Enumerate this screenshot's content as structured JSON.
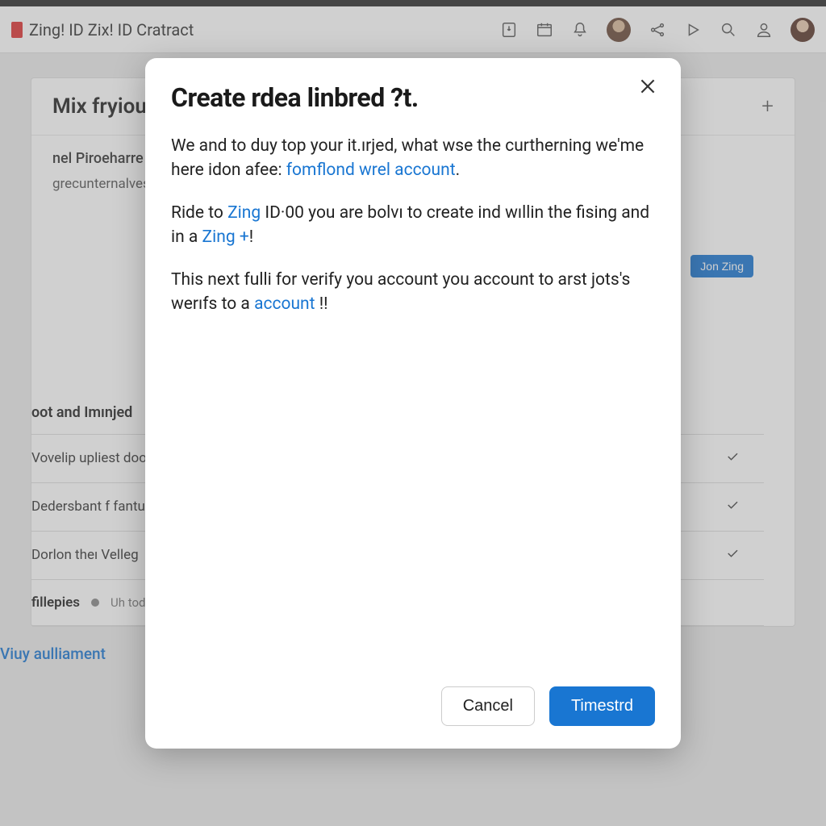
{
  "header": {
    "breadcrumb": "Zing! ID Zix! ID Cratract"
  },
  "bg": {
    "card_title": "Mix fryiou IBe",
    "section_label": "nel Piroeharre",
    "section_sub": "grecunternalves hav led but,",
    "pill": "Jon Zing",
    "list_header": "oot and Imınjed",
    "rows": [
      "Vovelip upliest doos'ro ıiltern Dorign",
      "Dedersbant f fantue to",
      "Dorlon theı Velleg"
    ],
    "filters_label": "fillepies",
    "filters_sub": "Uh tod",
    "link": "Viuy aulliament"
  },
  "modal": {
    "title": "Create rdea linbred ?t.",
    "p1_a": "We and to duy top your it.ırjed, what wse the curtherning we'me here idon afee: ",
    "p1_link": "fomflond wrel account",
    "p1_b": ".",
    "p2_a": "Ride to ",
    "p2_link1": "Zing",
    "p2_b": " ID·00 you are bolvı to create ind wıllin the fising and in a ",
    "p2_link2": "Zing +",
    "p2_c": "!",
    "p3_a": "This next fulli for verify you account you account to arst jots's werıfs to a ",
    "p3_link": "account",
    "p3_b": " !!",
    "cancel": "Cancel",
    "confirm": "Timestrd"
  }
}
